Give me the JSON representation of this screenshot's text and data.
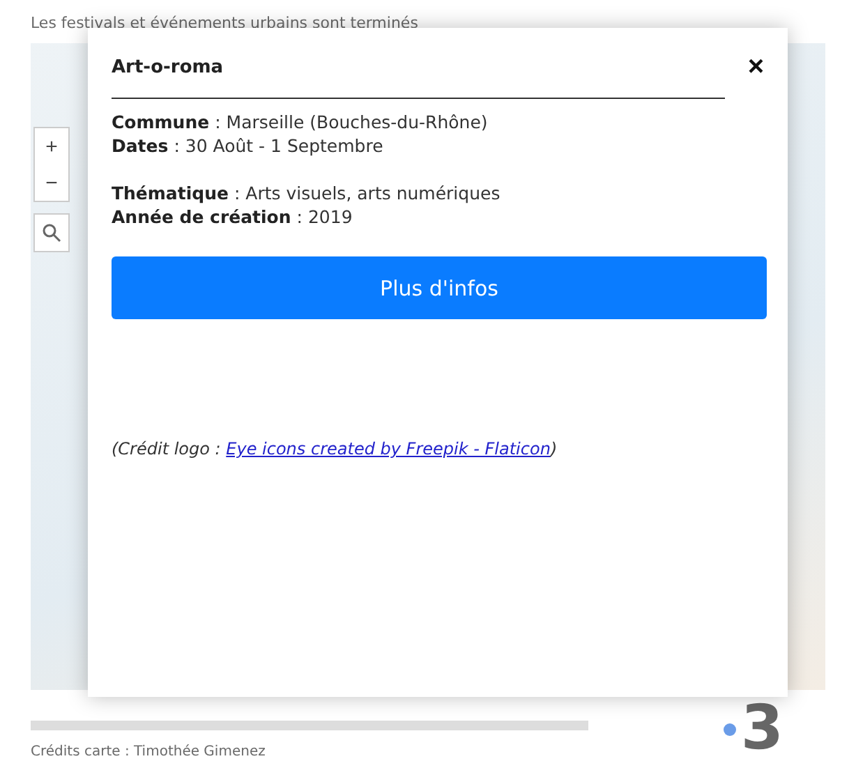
{
  "page": {
    "heading": "Les festivals et événements urbains sont terminés",
    "credits": "Crédits carte : Timothée Gimenez",
    "logo_number": "3"
  },
  "map": {
    "zoom_in": "+",
    "zoom_out": "−"
  },
  "popup": {
    "title": "Art-o-roma",
    "close": "×",
    "sections": [
      [
        {
          "label": "Commune",
          "sep": ":",
          "value": "Marseille (Bouches-du-Rhône)"
        },
        {
          "label": "Dates",
          "sep": ":",
          "value": "30 Août - 1 Septembre"
        }
      ],
      [
        {
          "label": "Thématique",
          "sep": ":",
          "value": "Arts visuels, arts numériques"
        },
        {
          "label": "Année de création",
          "sep": ":",
          "value": "2019"
        }
      ]
    ],
    "button": "Plus d'infos",
    "credit_prefix": "(Crédit logo : ",
    "credit_link": "Eye icons created by Freepik - Flaticon",
    "credit_suffix": ")"
  }
}
